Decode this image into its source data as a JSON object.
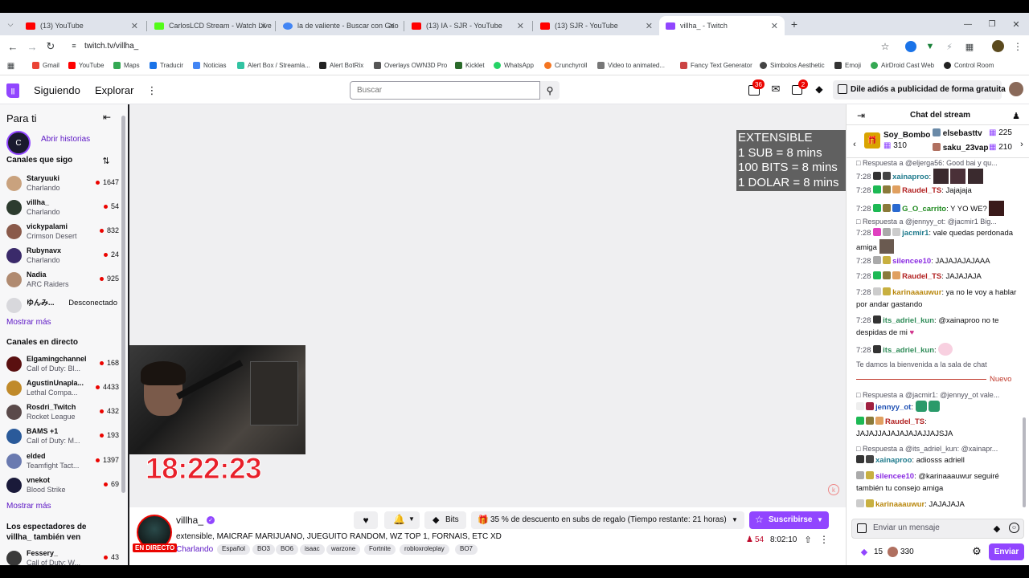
{
  "browser": {
    "tabs": [
      {
        "label": "(13) YouTube",
        "color": "#ff0000"
      },
      {
        "label": "CarlosLCD Stream - Watch Live",
        "color": "#53fc18"
      },
      {
        "label": "la de valiente - Buscar con Goo",
        "color": "#4285f4"
      },
      {
        "label": "(13) IA - SJR - YouTube",
        "color": "#ff0000"
      },
      {
        "label": "(13) SJR - YouTube",
        "color": "#ff0000"
      },
      {
        "label": "villha_ - Twitch",
        "color": "#9146ff"
      }
    ],
    "url": "twitch.tv/villha_",
    "bookmarks": [
      "Gmail",
      "YouTube",
      "Maps",
      "Traducir",
      "Noticias",
      "Alert Box / Streamla...",
      "Alert BotRix",
      "Overlays OWN3D Pro",
      "Kicklet",
      "WhatsApp",
      "Crunchyroll",
      "Video to animated...",
      "Fancy Text Generator",
      "Simbolos Aesthetic",
      "Emoji",
      "AirDroid Cast Web",
      "Control Room"
    ]
  },
  "nav": {
    "following": "Siguiendo",
    "browse": "Explorar",
    "search_placeholder": "Buscar",
    "inbox_count": "36",
    "whispers_count": "2",
    "ad_free": "Dile adiós a publicidad de forma gratuita"
  },
  "sidebar": {
    "for_you": "Para ti",
    "stories": "Abrir historias",
    "followed_header": "Canales que sigo",
    "followed": [
      {
        "name": "Staryuuki",
        "game": "Charlando",
        "viewers": "1647",
        "color": "#c9a27e"
      },
      {
        "name": "villha_",
        "game": "Charlando",
        "viewers": "54",
        "color": "#2c3b2e"
      },
      {
        "name": "vickypalami",
        "game": "Crimson Desert",
        "viewers": "832",
        "color": "#8a5a4a"
      },
      {
        "name": "Rubynavx",
        "game": "Charlando",
        "viewers": "24",
        "color": "#3a2a6a"
      },
      {
        "name": "Nadia",
        "game": "ARC Raiders",
        "viewers": "925",
        "color": "#b08a70"
      }
    ],
    "offline": {
      "name": "ゆんみ...",
      "status": "Desconectado"
    },
    "show_more": "Mostrar más",
    "live_header": "Canales en directo",
    "live": [
      {
        "name": "Elgamingchannel",
        "game": "Call of Duty: Bl...",
        "viewers": "168",
        "color": "#5a1010"
      },
      {
        "name": "AgustinUnapla...",
        "game": "Lethal Compa...",
        "viewers": "4433",
        "color": "#c08a2a"
      },
      {
        "name": "Rosdri_Twitch",
        "game": "Rocket League",
        "viewers": "432",
        "color": "#5a4a4a"
      },
      {
        "name": "BAMS +1",
        "game": "Call of Duty: M...",
        "viewers": "193",
        "color": "#2a5a9a"
      },
      {
        "name": "elded",
        "game": "Teamfight Tact...",
        "viewers": "1397",
        "color": "#6a7ab0"
      },
      {
        "name": "vnekot",
        "game": "Blood Strike",
        "viewers": "69",
        "color": "#1a1a3a"
      }
    ],
    "show_more2": "Mostrar más",
    "also_watch": "Los espectadores de villha_ también ven",
    "also": [
      {
        "name": "Fessery_",
        "game": "Call of Duty: W...",
        "viewers": "43",
        "color": "#3a3a3a"
      }
    ]
  },
  "stream": {
    "overlay_lines": [
      "EXTENSIBLE",
      "1 SUB = 8 mins",
      "100 BITS = 8 mins",
      "1 DOLAR = 8 mins"
    ],
    "timer": "18:22:23",
    "channel": "villha_",
    "title": "extensible, MAICRAF MARIJUANO, JUEGUITO RANDOM, WZ TOP 1, FORNAIS, ETC XD",
    "category": "Charlando",
    "live_badge": "EN DIRECTO",
    "tags": [
      "Español",
      "BO3",
      "BO6",
      "isaac",
      "warzone",
      "Fortnite",
      "robloxroleplay",
      "BO7"
    ],
    "bits": "Bits",
    "gift_promo": "35 % de descuento en subs de regalo (Tiempo restante: 21 horas)",
    "subscribe": "Suscribirse",
    "viewers": "54",
    "uptime": "8:02:10"
  },
  "chat": {
    "header": "Chat del stream",
    "leaders": [
      {
        "name": "Soy_Bombo",
        "value": "310"
      },
      {
        "name": "elsebasttv",
        "value": "225"
      },
      {
        "name": "saku_23vap",
        "value": "210"
      }
    ],
    "reply1": "Respuesta a @eljerga56: Good bai y qu...",
    "m1_time": "7:28",
    "m1_user": "xainaproo",
    "m2_time": "7:28",
    "m2_user": "Raudel_TS",
    "m2_text": "Jajajaja",
    "m3_time": "7:28",
    "m3_user": "G_O_carrito",
    "m3_text": "Y YO WE?",
    "reply2": "Respuesta a @jennyy_ot: @jacmir1 Big...",
    "m4_time": "7:28",
    "m4_user": "jacmir1",
    "m4_text": "vale quedas perdonada amiga",
    "m5_time": "7:28",
    "m5_user": "silencee10",
    "m5_text": "JAJAJAJAJAAA",
    "m6_time": "7:28",
    "m6_user": "Raudel_TS",
    "m6_text": "JAJAJAJA",
    "m7_time": "7:28",
    "m7_user": "karinaaauwur",
    "m7_text": "ya no le voy a hablar por andar gastando",
    "m8_time": "7:28",
    "m8_user": "its_adriel_kun",
    "m8_text": "@xainaproo no te despidas de mi",
    "m9_time": "7:28",
    "m9_user": "its_adriel_kun",
    "welcome": "Te damos la bienvenida a la sala de chat",
    "new_label": "Nuevo",
    "reply3": "Respuesta a @jacmir1: @jennyy_ot vale...",
    "m10_user": "jennyy_ot",
    "m11_user": "Raudel_TS",
    "m11_text": "JAJAJJAJAJAJAJAJJAJSJA",
    "reply4": "Respuesta a @its_adriel_kun: @xainapr...",
    "m12_user": "xainaproo",
    "m12_text": "adiosss adriell",
    "m13_user": "silencee10",
    "m13_text": "@karinaaauwur seguiré también tu consejo amiga",
    "m14_user": "karinaaauwur",
    "m14_text": "JAJAJAJA",
    "input_placeholder": "Enviar un mensaje",
    "points": "15",
    "points2": "330",
    "send": "Enviar"
  }
}
